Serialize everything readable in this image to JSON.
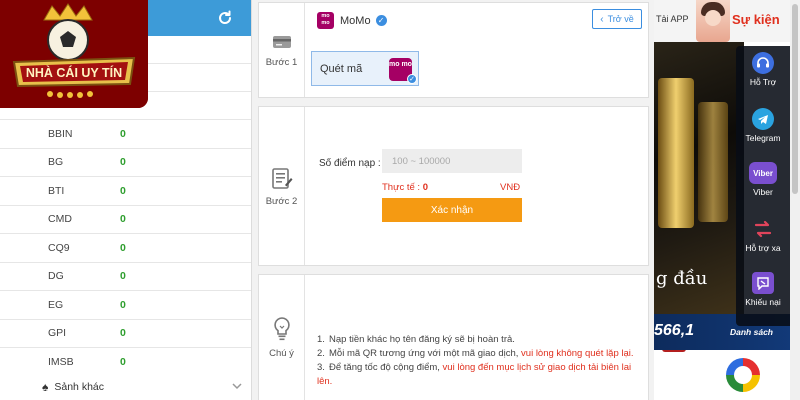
{
  "wallet": {
    "items": [
      {
        "name": "BBIN",
        "value": "0"
      },
      {
        "name": "BG",
        "value": "0"
      },
      {
        "name": "BTI",
        "value": "0"
      },
      {
        "name": "CMD",
        "value": "0"
      },
      {
        "name": "CQ9",
        "value": "0"
      },
      {
        "name": "DG",
        "value": "0"
      },
      {
        "name": "EG",
        "value": "0"
      },
      {
        "name": "GPI",
        "value": "0"
      },
      {
        "name": "IMSB",
        "value": "0"
      }
    ],
    "more_label": "Sảnh khác"
  },
  "logo": {
    "text": "NHÀ CÁI UY TÍN"
  },
  "step1": {
    "label": "Bước 1",
    "method_name": "MoMo",
    "momo_badge": "mo mo",
    "back_label": "Trở về",
    "option_label": "Quét mã"
  },
  "step2": {
    "label": "Bước 2",
    "amount_label": "Số điểm nạp :",
    "amount_placeholder": "100 ~ 100000",
    "actual_label": "Thực tế :",
    "actual_value": "0",
    "currency": "VNĐ",
    "confirm_label": "Xác nhận"
  },
  "step3": {
    "label": "Chú ý",
    "notes": [
      {
        "num": "1.",
        "text": "Nạp tiền khác họ tên đăng ký sẽ bị hoàn trả.",
        "red": ""
      },
      {
        "num": "2.",
        "text": "Mỗi mã QR tương ứng với một mã giao dịch, ",
        "red": "vui lòng không quét lặp lại."
      },
      {
        "num": "3.",
        "text": "Để tăng tốc độ cộng điểm, ",
        "red": "vui lòng đến mục lịch sử giao dịch tải biên lai lên."
      }
    ]
  },
  "promo": {
    "tai_app": "Tải APP",
    "event": "Sự kiện",
    "headline": "g đầu",
    "amount": "566,1",
    "list": "Danh sách"
  },
  "toolbar": {
    "items": [
      {
        "label": "Hỗ Trợ",
        "icon": "headset-icon",
        "color": "#3d6fe0"
      },
      {
        "label": "Telegram",
        "icon": "telegram-icon",
        "color": "#2aa3e0"
      },
      {
        "label": "Viber",
        "icon": "viber-icon",
        "color": "#7a4fcf"
      },
      {
        "label": "Hỗ trợ xa",
        "icon": "remote-support-icon",
        "color": "#e0445b"
      },
      {
        "label": "Khiếu nại",
        "icon": "complaint-icon",
        "color": "#7a4fcf"
      }
    ]
  },
  "colors": {
    "header_blue": "#3d9bd8",
    "momo": "#a50064",
    "confirm_orange": "#f59a12",
    "warning_red": "#e0301e",
    "value_green": "#2e9e2e",
    "accent_blue": "#3b8ee0"
  }
}
